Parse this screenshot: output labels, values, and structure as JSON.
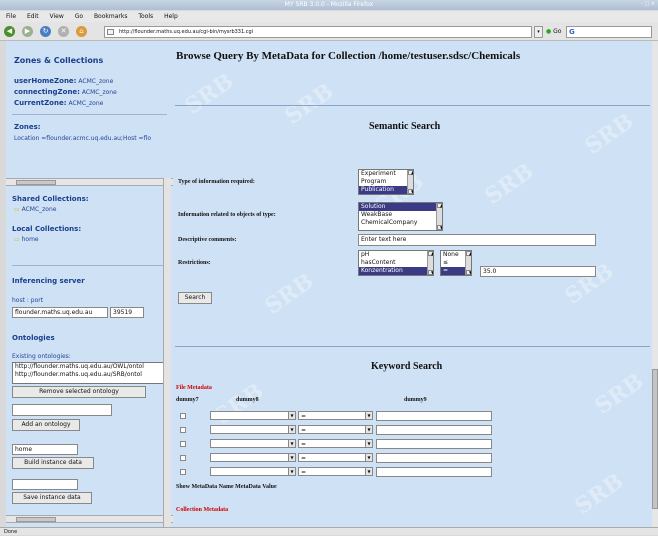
{
  "window": {
    "title": "MY SRB 3.0.0 - Mozilla Firefox",
    "controls": "- □ ×"
  },
  "menu": [
    "File",
    "Edit",
    "View",
    "Go",
    "Bookmarks",
    "Tools",
    "Help"
  ],
  "nav": {
    "url": "http://flounder.maths.uq.edu.au/cgi-bin/mysrb331.cgi",
    "go_label": "Go",
    "search_letter": "G"
  },
  "left": {
    "zones_title": "Zones & Collections",
    "user_home_label": "userHomeZone:",
    "user_home_value": "ACMC_zone",
    "connecting_label": "connectingZone:",
    "connecting_value": "ACMC_zone",
    "current_label": "CurrentZone:",
    "current_value": "ACMC_zone",
    "zones_label": "Zones:",
    "location": "Location =flounder.acmc.uq.edu.au;Host =flo",
    "shared_title": "Shared Collections:",
    "shared_item": "ACMC_zone",
    "local_title": "Local Collections:",
    "local_item": "home",
    "inferencing_title": "Inferencing server",
    "host_port_label": "host : port",
    "host_value": "flounder.maths.uq.edu.au",
    "port_value": "39519",
    "ontologies_title": "Ontologies",
    "existing_label": "Existing ontologies:",
    "ontology_items": [
      "http://flounder.maths.uq.edu.au/OWL/ontol",
      "http://flounder.maths.uq.edu.au/SRB/ontol"
    ],
    "remove_btn": "Remove selected ontology",
    "add_btn": "Add an ontology",
    "instance_value": "home",
    "build_btn": "Build instance data",
    "save_btn": "Save instance data"
  },
  "main": {
    "page_title": "Browse Query By MetaData for Collection /home/testuser.sdsc/Chemicals",
    "semantic_title": "Semantic Search",
    "type_label": "Type of information required:",
    "type_options": [
      "Experiment",
      "Program",
      "Publication"
    ],
    "related_label": "Information related to objects of type:",
    "related_options": [
      "Solution",
      "WeakBase",
      "ChemicalCompany"
    ],
    "comments_label": "Descriptive comments:",
    "comments_value": "Enter text here",
    "restrictions_label": "Restrictions:",
    "restriction_props": [
      "pH",
      "hasContent",
      "Konzentration"
    ],
    "restriction_ops": [
      "None",
      "≤",
      "="
    ],
    "restriction_value": "35.0",
    "search_btn": "Search",
    "keyword_title": "Keyword Search",
    "file_meta_label": "File Metadata",
    "col_dummy7": "dummy7",
    "col_dummy8": "dummy8",
    "col_dummy9": "dummy9",
    "op_eq": "=",
    "show_meta": "Show MetaData Name  MetaData Value",
    "collection_meta_label": "Collection Metadata"
  },
  "status": "Done",
  "watermark": "SRB"
}
